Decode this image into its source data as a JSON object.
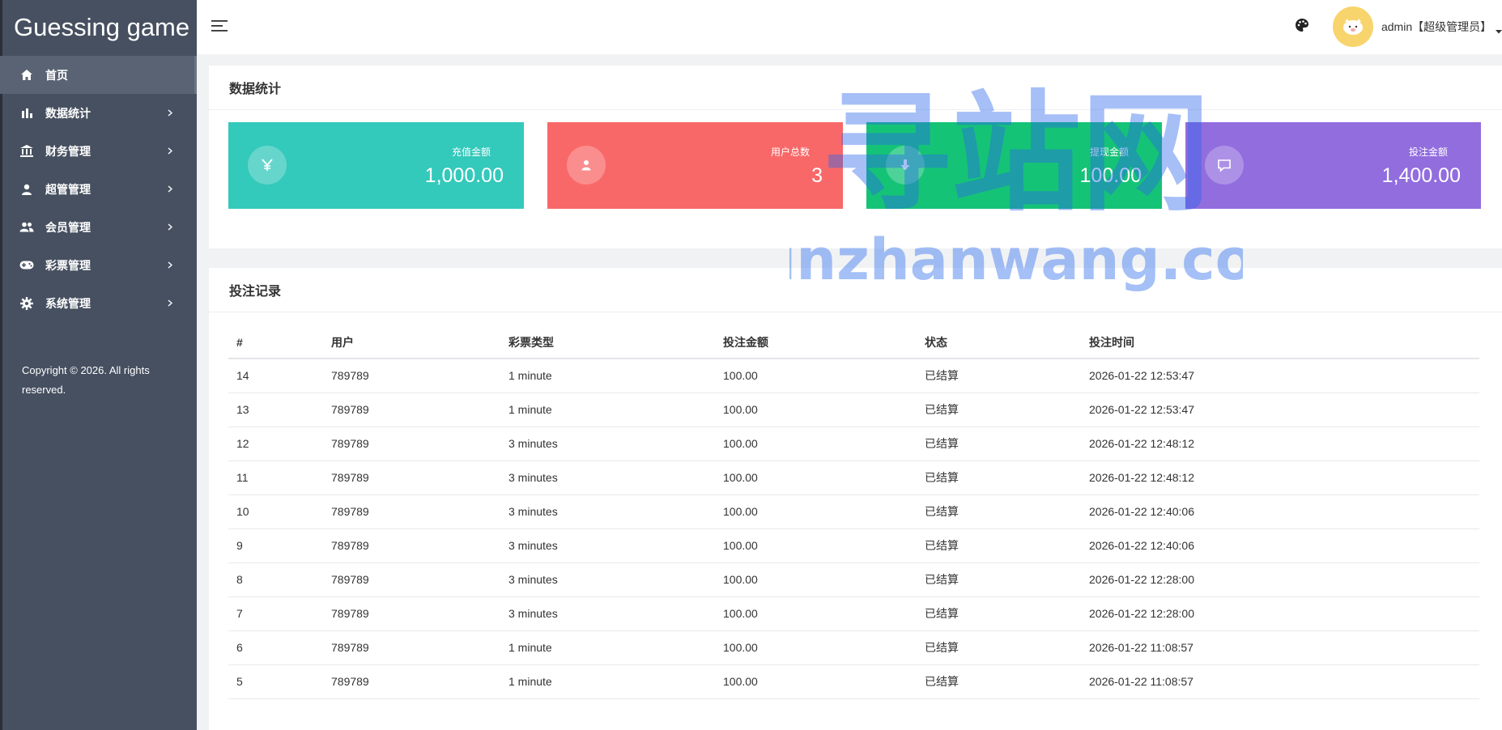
{
  "app": {
    "title": "Guessing game"
  },
  "sidebar": {
    "items": [
      {
        "label": "首页",
        "icon": "home-icon",
        "active": true
      },
      {
        "label": "数据统计",
        "icon": "bar-chart-icon"
      },
      {
        "label": "财务管理",
        "icon": "bank-icon"
      },
      {
        "label": "超管管理",
        "icon": "user-icon"
      },
      {
        "label": "会员管理",
        "icon": "users-icon"
      },
      {
        "label": "彩票管理",
        "icon": "gamepad-icon"
      },
      {
        "label": "系统管理",
        "icon": "gear-icon"
      }
    ],
    "copyright": "Copyright © 2026. All rights reserved."
  },
  "header": {
    "user_name": "admin【超级管理员】"
  },
  "stats": {
    "title": "数据统计",
    "cards": [
      {
        "label": "充值金额",
        "value": "1,000.00",
        "icon": "yen-icon",
        "color": "#33c9bb"
      },
      {
        "label": "用户总数",
        "value": "3",
        "icon": "user-icon",
        "color": "#f96868"
      },
      {
        "label": "提现金额",
        "value": "100.00",
        "icon": "arrow-down-icon",
        "color": "#15c377"
      },
      {
        "label": "投注金额",
        "value": "1,400.00",
        "icon": "message-icon",
        "color": "#926dde"
      }
    ]
  },
  "bets": {
    "title": "投注记录",
    "columns": [
      "#",
      "用户",
      "彩票类型",
      "投注金额",
      "状态",
      "投注时间"
    ],
    "rows": [
      [
        "14",
        "789789",
        "1 minute",
        "100.00",
        "已结算",
        "2026-01-22 12:53:47"
      ],
      [
        "13",
        "789789",
        "1 minute",
        "100.00",
        "已结算",
        "2026-01-22 12:53:47"
      ],
      [
        "12",
        "789789",
        "3 minutes",
        "100.00",
        "已结算",
        "2026-01-22 12:48:12"
      ],
      [
        "11",
        "789789",
        "3 minutes",
        "100.00",
        "已结算",
        "2026-01-22 12:48:12"
      ],
      [
        "10",
        "789789",
        "3 minutes",
        "100.00",
        "已结算",
        "2026-01-22 12:40:06"
      ],
      [
        "9",
        "789789",
        "3 minutes",
        "100.00",
        "已结算",
        "2026-01-22 12:40:06"
      ],
      [
        "8",
        "789789",
        "3 minutes",
        "100.00",
        "已结算",
        "2026-01-22 12:28:00"
      ],
      [
        "7",
        "789789",
        "3 minutes",
        "100.00",
        "已结算",
        "2026-01-22 12:28:00"
      ],
      [
        "6",
        "789789",
        "1 minute",
        "100.00",
        "已结算",
        "2026-01-22 11:08:57"
      ],
      [
        "5",
        "789789",
        "1 minute",
        "100.00",
        "已结算",
        "2026-01-22 11:08:57"
      ]
    ]
  },
  "watermark": {
    "line1": "寻站网",
    "line2": "xunzhanwang.com"
  }
}
